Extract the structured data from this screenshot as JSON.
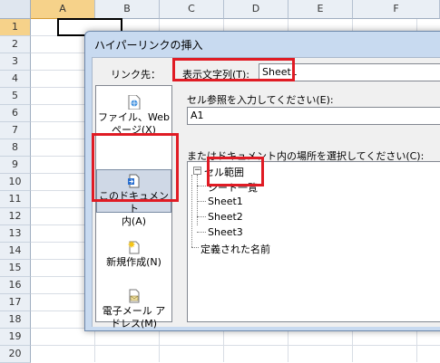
{
  "sheet": {
    "columns": [
      "A",
      "B",
      "C",
      "D",
      "E",
      "F"
    ],
    "selected_column": "A",
    "rows": [
      "1",
      "2",
      "3",
      "4",
      "5",
      "6",
      "7",
      "8",
      "9",
      "10",
      "11",
      "12",
      "13",
      "14",
      "15",
      "16",
      "17",
      "18",
      "19",
      "20"
    ],
    "selected_row": "1"
  },
  "dialog": {
    "title": "ハイパーリンクの挿入",
    "link_to_label": "リンク先：",
    "link_options": [
      {
        "label_line1": "ファイル、Web",
        "label_line2": "ページ(X)",
        "icon": "web-page-icon"
      },
      {
        "label_line1": "このドキュメント",
        "label_line2": "内(A)",
        "icon": "document-icon"
      },
      {
        "label_line1": "",
        "label_line2": "新規作成(N)",
        "icon": "new-document-icon"
      },
      {
        "label_line1": "電子メール ア",
        "label_line2": "ドレス(M)",
        "icon": "email-icon"
      }
    ],
    "display_text_label": "表示文字列(T):",
    "display_text_value": "Sheet1",
    "cell_ref_label": "セル参照を入力してください(E):",
    "cell_ref_value": "A1",
    "place_label": "またはドキュメント内の場所を選択してください(C):",
    "tree": {
      "root": "セル範囲",
      "root_expander": "−",
      "children": [
        "シート一覧",
        "Sheet1",
        "Sheet2",
        "Sheet3"
      ],
      "defined_names": "定義された名前"
    }
  }
}
